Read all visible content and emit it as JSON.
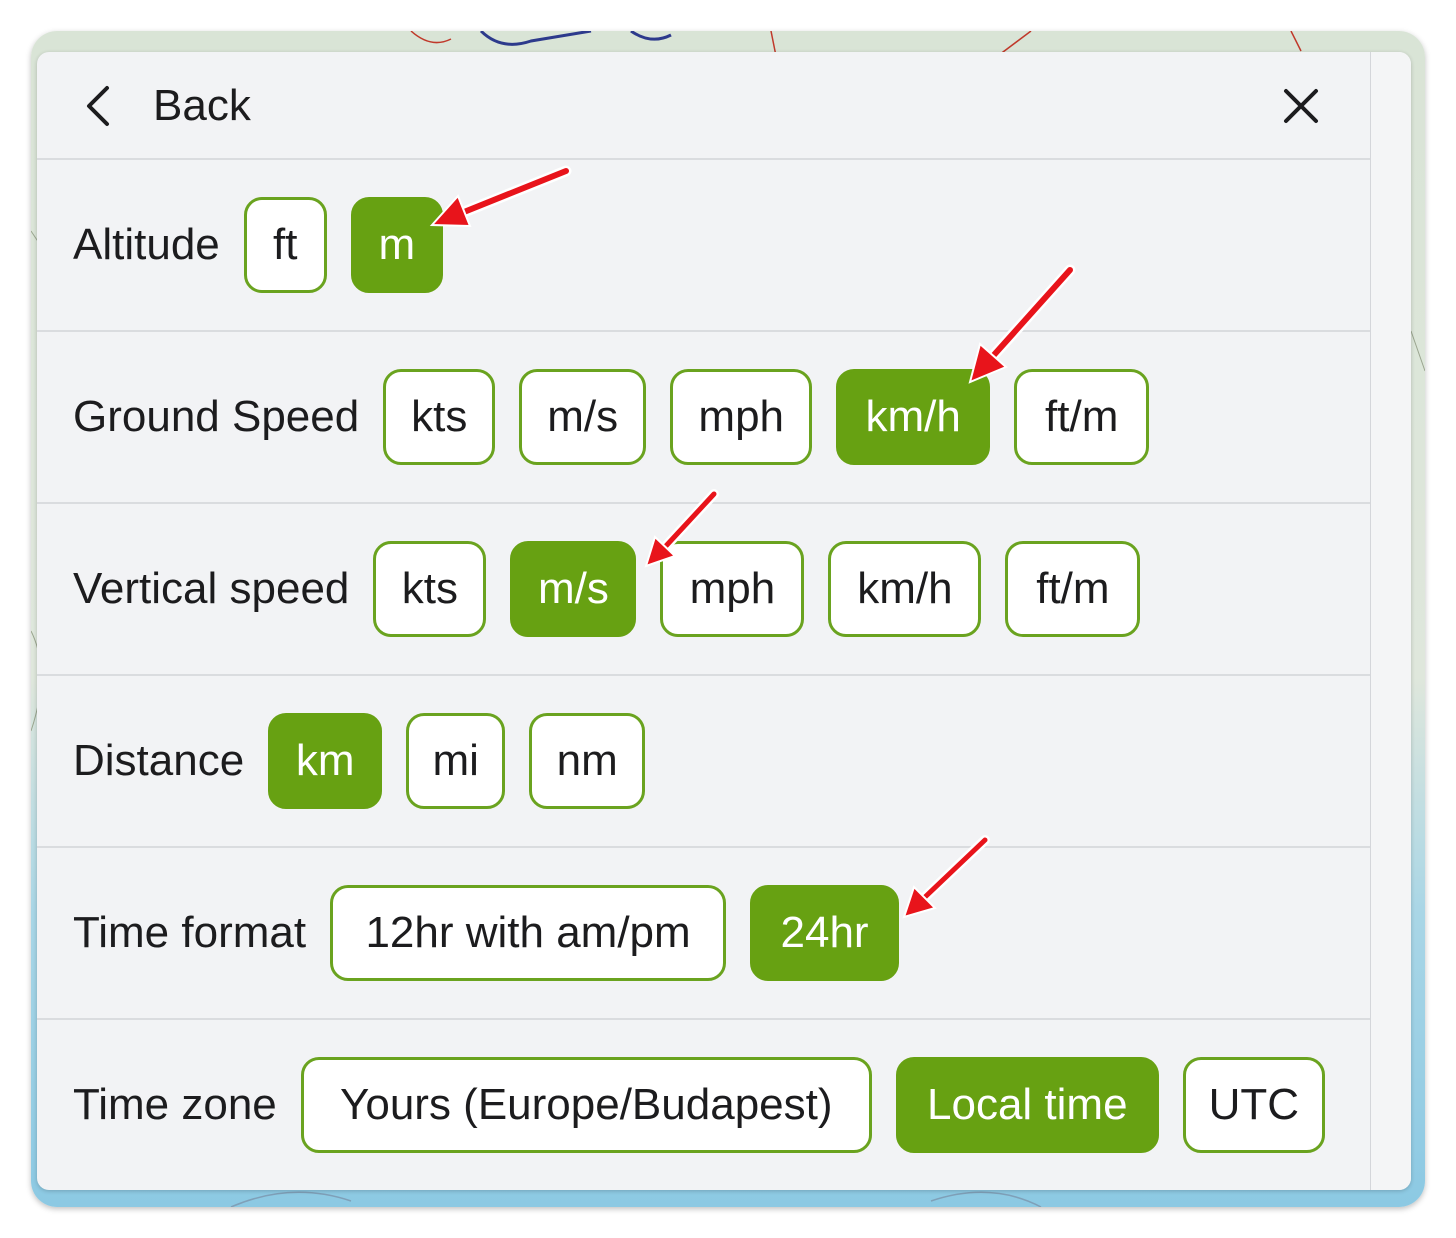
{
  "header": {
    "back_label": "Back"
  },
  "settings": [
    {
      "label": "Altitude",
      "options": [
        "ft",
        "m"
      ],
      "selected": "m"
    },
    {
      "label": "Ground Speed",
      "options": [
        "kts",
        "m/s",
        "mph",
        "km/h",
        "ft/m"
      ],
      "selected": "km/h"
    },
    {
      "label": "Vertical speed",
      "options": [
        "kts",
        "m/s",
        "mph",
        "km/h",
        "ft/m"
      ],
      "selected": "m/s"
    },
    {
      "label": "Distance",
      "options": [
        "km",
        "mi",
        "nm"
      ],
      "selected": "km"
    },
    {
      "label": "Time format",
      "options": [
        "12hr with am/pm",
        "24hr"
      ],
      "selected": "24hr"
    },
    {
      "label": "Time zone",
      "options": [
        "Yours (Europe/Budapest)",
        "Local time",
        "UTC"
      ],
      "selected": "Local time"
    }
  ],
  "colors": {
    "accent": "#67a112",
    "annotation_arrow": "#e8141b"
  },
  "icons": {
    "back": "chevron-left-icon",
    "close": "close-icon"
  }
}
